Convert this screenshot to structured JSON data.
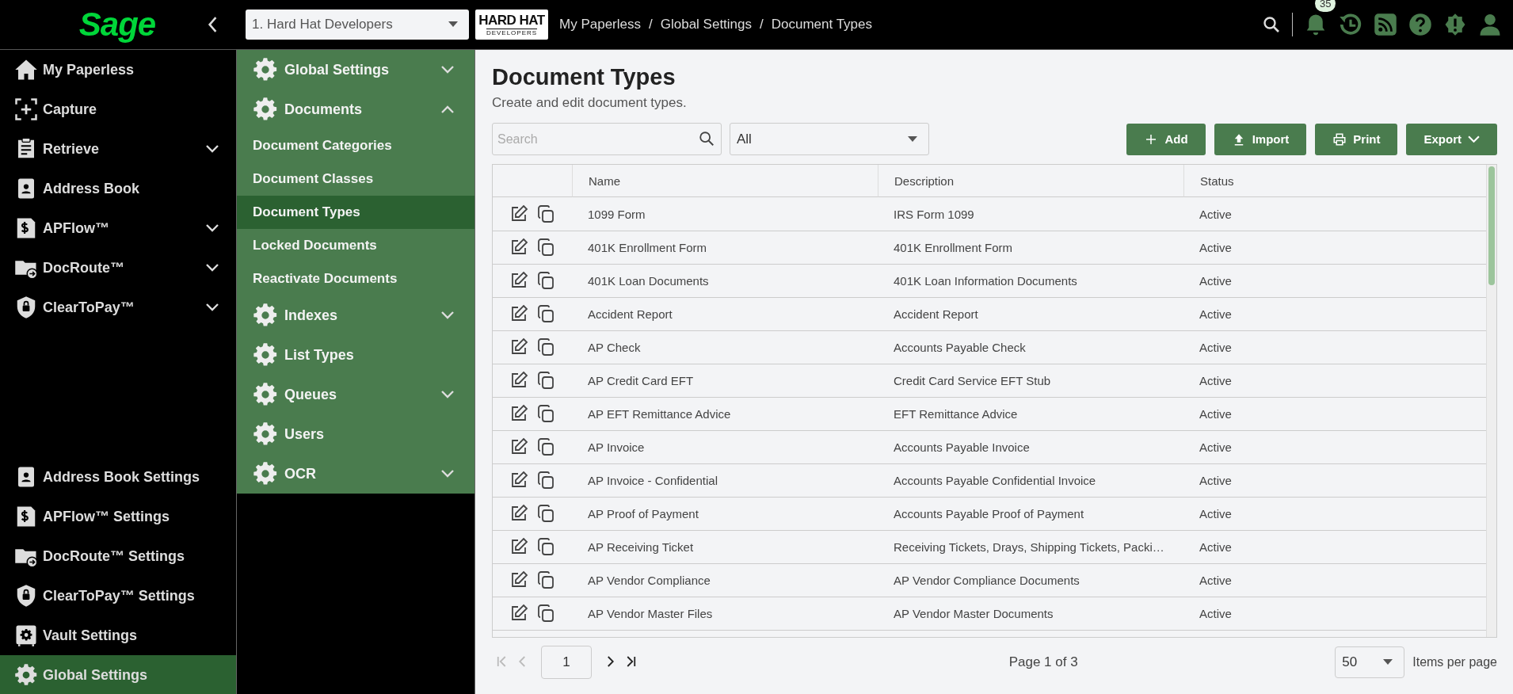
{
  "top_bar": {
    "logo": "Sage",
    "company_select": {
      "value": "1. Hard Hat Developers"
    },
    "company_logo": {
      "title": "HARD HAT",
      "subtitle": "DEVELOPERS"
    },
    "breadcrumbs": [
      "My Paperless",
      "Global Settings",
      "Document Types"
    ],
    "breadcrumb_separators": [
      "/",
      "/"
    ],
    "notification_count": "35"
  },
  "sidebar": {
    "items": [
      {
        "label": "My Paperless",
        "kind": "link",
        "selected": false
      },
      {
        "label": "Capture",
        "kind": "link",
        "selected": false
      },
      {
        "label": "Retrieve",
        "kind": "menu",
        "expanded": false,
        "selected": false
      },
      {
        "label": "Address Book",
        "kind": "link",
        "selected": false
      },
      {
        "label": "APFlow™",
        "kind": "menu",
        "expanded": false,
        "selected": false
      },
      {
        "label": "DocRoute™",
        "kind": "menu",
        "expanded": false,
        "selected": false
      },
      {
        "label": "ClearToPay™",
        "kind": "menu",
        "expanded": false,
        "selected": false
      }
    ],
    "bottom_items": [
      {
        "label": "Address Book Settings",
        "selected": false
      },
      {
        "label": "APFlow™ Settings",
        "selected": false
      },
      {
        "label": "DocRoute™ Settings",
        "selected": false
      },
      {
        "label": "ClearToPay™ Settings",
        "selected": false
      },
      {
        "label": "Vault Settings",
        "selected": false
      },
      {
        "label": "Global Settings",
        "selected": true
      }
    ]
  },
  "subnav": {
    "items": [
      {
        "label": "Global Settings",
        "kind": "menu",
        "expanded": false,
        "selected": false
      },
      {
        "label": "Documents",
        "kind": "menu",
        "expanded": true,
        "selected": false,
        "children": [
          {
            "label": "Document Categories",
            "selected": false
          },
          {
            "label": "Document Classes",
            "selected": false
          },
          {
            "label": "Document Types",
            "selected": true
          },
          {
            "label": "Locked Documents",
            "selected": false
          },
          {
            "label": "Reactivate Documents",
            "selected": false
          }
        ]
      },
      {
        "label": "Indexes",
        "kind": "menu",
        "expanded": false,
        "selected": false
      },
      {
        "label": "List Types",
        "kind": "link",
        "selected": false
      },
      {
        "label": "Queues",
        "kind": "menu",
        "expanded": false,
        "selected": false
      },
      {
        "label": "Users",
        "kind": "link",
        "selected": false
      },
      {
        "label": "OCR",
        "kind": "menu",
        "expanded": false,
        "selected": false
      }
    ]
  },
  "page": {
    "title": "Document Types",
    "subtitle": "Create and edit document types.",
    "search": {
      "placeholder": "Search"
    },
    "filter": {
      "value": "All"
    },
    "buttons": [
      {
        "label": "Add",
        "kind": "add"
      },
      {
        "label": "Import",
        "kind": "import"
      },
      {
        "label": "Print",
        "kind": "print"
      },
      {
        "label": "Export",
        "kind": "export"
      }
    ]
  },
  "table": {
    "columns": [
      "Name",
      "Description",
      "Status"
    ],
    "rows": [
      [
        "1099 Form",
        "IRS Form 1099",
        "Active"
      ],
      [
        "401K Enrollment Form",
        "401K Enrollment Form",
        "Active"
      ],
      [
        "401K Loan Documents",
        "401K Loan Information Documents",
        "Active"
      ],
      [
        "Accident Report",
        "Accident Report",
        "Active"
      ],
      [
        "AP Check",
        "Accounts Payable Check",
        "Active"
      ],
      [
        "AP Credit Card EFT",
        "Credit Card Service EFT Stub",
        "Active"
      ],
      [
        "AP EFT Remittance Advice",
        "EFT Remittance Advice",
        "Active"
      ],
      [
        "AP Invoice",
        "Accounts Payable Invoice",
        "Active"
      ],
      [
        "AP Invoice - Confidential",
        "Accounts Payable Confidential Invoice",
        "Active"
      ],
      [
        "AP Proof of Payment",
        "Accounts Payable Proof of Payment",
        "Active"
      ],
      [
        "AP Receiving Ticket",
        "Receiving Tickets, Drays, Shipping Tickets, Packi…",
        "Active"
      ],
      [
        "AP Vendor Compliance",
        "AP Vendor Compliance Documents",
        "Active"
      ],
      [
        "AP Vendor Master Files",
        "AP Vendor Master Documents",
        "Active"
      ]
    ]
  },
  "pagination": {
    "first": {
      "disabled": true
    },
    "previous": {
      "disabled": true
    },
    "page": "1",
    "next": {
      "disabled": false
    },
    "last": {
      "disabled": false
    },
    "summary": "Page 1 of 3",
    "page_size": "50",
    "page_size_label": "Items per page"
  }
}
